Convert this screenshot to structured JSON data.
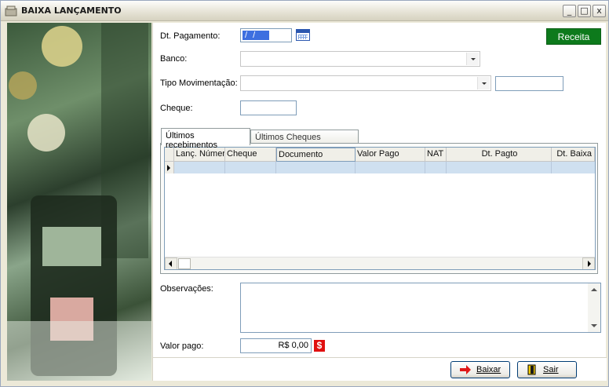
{
  "window": {
    "title": "BAIXA LANÇAMENTO",
    "controls": {
      "minimize": "_",
      "maximize": "□",
      "close": "x"
    }
  },
  "form": {
    "dt_pagamento": {
      "label": "Dt. Pagamento:",
      "value": "/ /"
    },
    "banco": {
      "label": "Banco:",
      "value": ""
    },
    "tipo_movimentacao": {
      "label": "Tipo Movimentação:",
      "value": "",
      "extra_value": ""
    },
    "cheque": {
      "label": "Cheque:",
      "value": ""
    },
    "receita_button": "Receita"
  },
  "tabs": [
    {
      "label": "Últimos recebimentos",
      "active": true
    },
    {
      "label": "Últimos Cheques Utilizados",
      "active": false
    }
  ],
  "grid": {
    "columns": [
      "Lanç. Númer",
      "Cheque",
      "Documento",
      "Valor Pago",
      "NAT",
      "Dt. Pagto",
      "Dt. Baixa"
    ],
    "rows": [
      [
        "",
        "",
        "",
        "",
        "",
        "",
        ""
      ]
    ]
  },
  "observacoes": {
    "label": "Observações:",
    "value": ""
  },
  "valor_pago": {
    "label": "Valor pago:",
    "value": "R$ 0,00",
    "icon_text": "$"
  },
  "buttons": {
    "baixar": "Baixar",
    "sair": "Sair"
  },
  "colors": {
    "receita_bg": "#0d7a1c",
    "selection": "#3d6fe0",
    "grid_row": "#cfe0f0",
    "money_icon": "#e01010"
  }
}
